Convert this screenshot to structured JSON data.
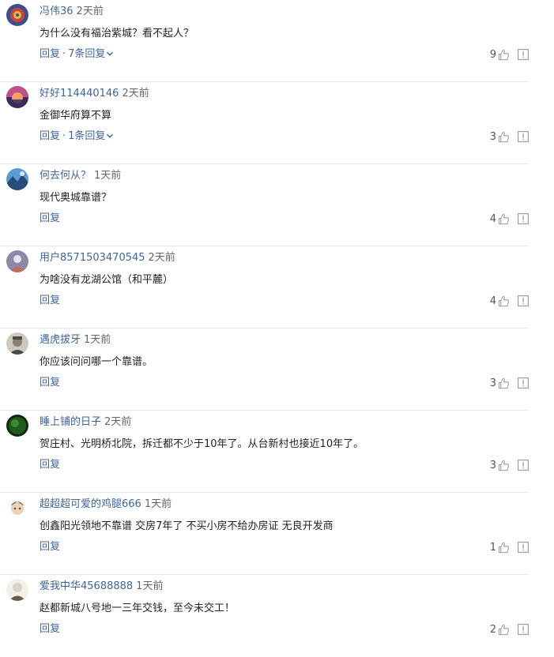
{
  "comments": [
    {
      "username": "冯伟36",
      "time": "2天前",
      "content": "为什么没有福治紫城？看不起人？",
      "reply_label": "回复",
      "separator": "·",
      "replies_label": "7条回复",
      "likes": "9",
      "avatar_icon": "avatar-colorful-icon",
      "colors": {
        "a": "#3a4f8c",
        "b": "#c9453a",
        "c": "#e8b64a"
      }
    },
    {
      "username": "好好114440146",
      "time": "2天前",
      "content": "金御华府算不算",
      "reply_label": "回复",
      "separator": "·",
      "replies_label": "1条回复",
      "likes": "3",
      "avatar_icon": "avatar-sunset-icon",
      "colors": {
        "a": "#f2a06a",
        "b": "#c0508a",
        "c": "#3d2a5c"
      }
    },
    {
      "username": "何去何从？",
      "time": "1天前",
      "content": "现代奥城靠谱？",
      "reply_label": "回复",
      "likes": "4",
      "avatar_icon": "avatar-landscape-icon",
      "colors": {
        "a": "#5a9ad6",
        "b": "#2a4a7a",
        "c": "#dfe9f5"
      }
    },
    {
      "username": "用户8571503470545",
      "time": "2天前",
      "content": "为啥没有龙湖公馆（和平麓）",
      "reply_label": "回复",
      "likes": "4",
      "avatar_icon": "avatar-default-icon",
      "colors": {
        "a": "#8f86a8",
        "b": "#c46a5a",
        "c": "#e7e3ee"
      }
    },
    {
      "username": "遇虎拔牙",
      "time": "1天前",
      "content": "你应该问问哪一个靠谱。",
      "reply_label": "回复",
      "likes": "3",
      "avatar_icon": "avatar-portrait-icon",
      "colors": {
        "a": "#4a4a4a",
        "b": "#cfc8bd",
        "c": "#8a8170"
      }
    },
    {
      "username": "睡上铺的日子",
      "time": "2天前",
      "content": "贺庄村、光明桥北院，拆迁都不少于10年了。从台新村也接近10年了。",
      "reply_label": "回复",
      "likes": "3",
      "avatar_icon": "avatar-green-icon",
      "colors": {
        "a": "#1f5a1f",
        "b": "#3e8a2e",
        "c": "#0f2a10"
      }
    },
    {
      "username": "超超超可爱的鸡腿666",
      "time": "1天前",
      "content": "创鑫阳光领地不靠谱 交房7年了 不买小房不给办房证 无良开发商",
      "reply_label": "回复",
      "likes": "1",
      "avatar_icon": "avatar-anime-icon",
      "colors": {
        "a": "#6b4a2e",
        "b": "#e9d3b5",
        "c": "#ffffff"
      }
    },
    {
      "username": "爱我中华45688888",
      "time": "1天前",
      "content": "赵都新城八号地一三年交钱，至今未交工！",
      "reply_label": "回复",
      "likes": "2",
      "avatar_icon": "avatar-person-icon",
      "colors": {
        "a": "#d9d2c8",
        "b": "#6e5a48",
        "c": "#f3efe9"
      }
    }
  ],
  "icons": {
    "like": "thumbs-up-icon",
    "report": "report-icon",
    "expand": "chevron-down-icon"
  },
  "colors": {
    "link": "#406599",
    "text": "#222222",
    "muted": "#666666",
    "divider": "#e8e8e8",
    "icon": "#999999"
  }
}
